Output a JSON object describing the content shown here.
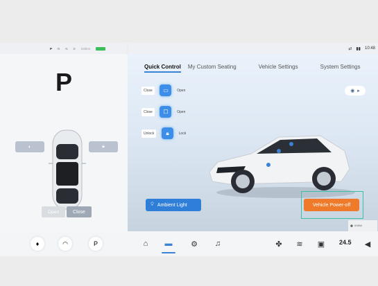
{
  "status_bar": {
    "gears": [
      "P",
      "R",
      "N",
      "D"
    ],
    "range": "040km",
    "time": "10:48",
    "icons": [
      "share-icon",
      "signal-icon",
      "battery-icon"
    ]
  },
  "left_panel": {
    "gear_display": "P",
    "trunk_open_label": "Open",
    "trunk_close_label": "Close"
  },
  "main": {
    "tabs": [
      "Quick Control",
      "My Custom Seating",
      "Vehicle Settings",
      "System Settings"
    ],
    "quick_controls": [
      {
        "left": "Close",
        "right": "Open",
        "icon": "window-icon"
      },
      {
        "left": "Close",
        "right": "Open",
        "icon": "sunroof-icon"
      },
      {
        "left": "Unlock",
        "right": "Lock",
        "icon": "lock-icon"
      }
    ],
    "ambient_light_label": "Ambient Light",
    "power_off_label": "Vehicle Power-off",
    "brand_text": "ANWAI"
  },
  "bottom_bar": {
    "temperature": "24.5",
    "icons_left": [
      "flashlight-icon",
      "wiper-icon",
      "parking-icon"
    ],
    "icons_center": [
      "home-icon",
      "car-icon",
      "settings-icon",
      "music-icon"
    ],
    "icons_right": [
      "fan-icon",
      "seat-heat-icon",
      "phone-icon",
      "volume-icon"
    ]
  },
  "colors": {
    "accent": "#3b82d6",
    "orange": "#ef7a2a",
    "battery_green": "#3bbf5b"
  }
}
